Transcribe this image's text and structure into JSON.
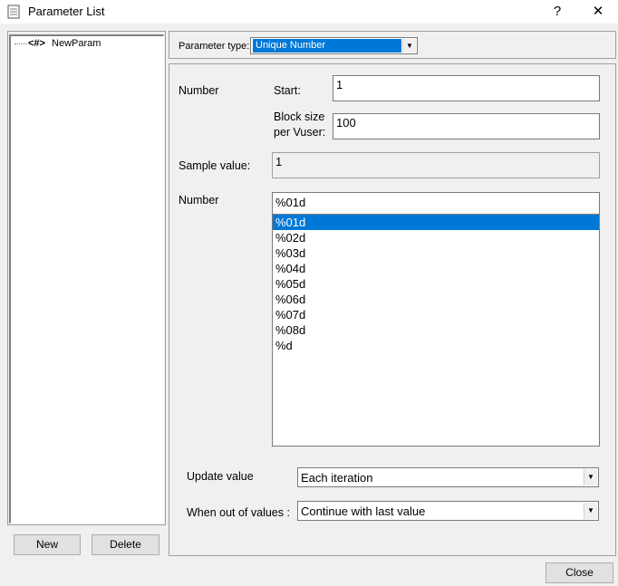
{
  "window": {
    "title": "Parameter List",
    "help": "?",
    "close": "✕"
  },
  "tree": {
    "items": [
      {
        "icon": "<#>",
        "label": "NewParam"
      }
    ]
  },
  "buttons": {
    "new": "New",
    "delete": "Delete",
    "close": "Close"
  },
  "param_type": {
    "label": "Parameter type:",
    "value": "Unique Number"
  },
  "number_section": {
    "heading": "Number",
    "start_label": "Start:",
    "start_value": "1",
    "block_label_line1": "Block size",
    "block_label_line2": "per Vuser:",
    "block_value": "100"
  },
  "sample": {
    "label": "Sample value:",
    "value": "1"
  },
  "format": {
    "label": "Number",
    "value": "%01d",
    "options": [
      "%01d",
      "%02d",
      "%03d",
      "%04d",
      "%05d",
      "%06d",
      "%07d",
      "%08d",
      "%d"
    ],
    "selected_index": 0
  },
  "update_value": {
    "label": "Update value",
    "value": "Each iteration"
  },
  "out_of_values": {
    "label": "When out of values :",
    "value": "Continue with last value"
  },
  "colors": {
    "selection": "#0078d7",
    "window_bg": "#f0f0f0"
  }
}
